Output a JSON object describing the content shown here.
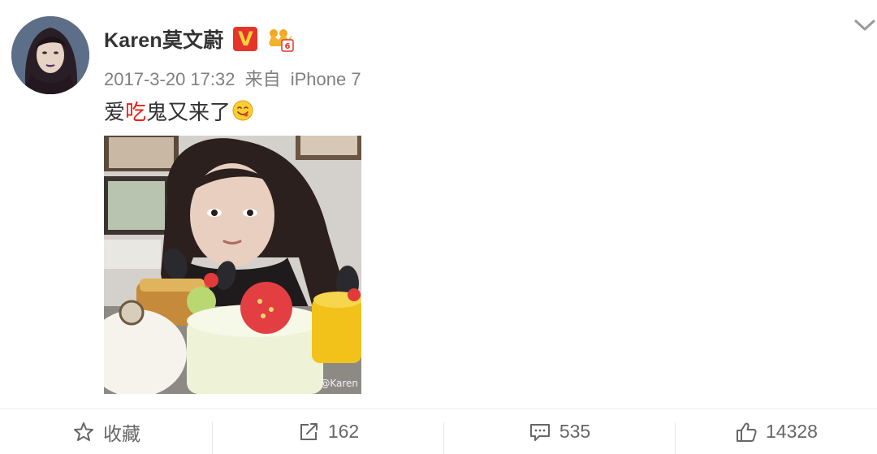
{
  "post": {
    "author": "Karen莫文蔚",
    "verified_badge": "V",
    "timestamp": "2017-3-20 17:32",
    "source_prefix": "来自",
    "source_device": "iPhone 7",
    "text_before": "爱",
    "text_highlight": "吃",
    "text_after": "鬼又来了",
    "emoji": "smiling-yum-emoji",
    "image_watermark": "@Karen",
    "colors": {
      "verified_badge_bg": "#e5352b",
      "highlight_text": "#e8221a",
      "meta_text": "#808080"
    }
  },
  "actions": {
    "favorite": {
      "icon": "star-outline-icon",
      "label": "收藏"
    },
    "repost": {
      "icon": "share-arrow-icon",
      "count": "162"
    },
    "comment": {
      "icon": "comment-icon",
      "count": "535"
    },
    "like": {
      "icon": "thumbs-up-icon",
      "count": "14328"
    }
  }
}
